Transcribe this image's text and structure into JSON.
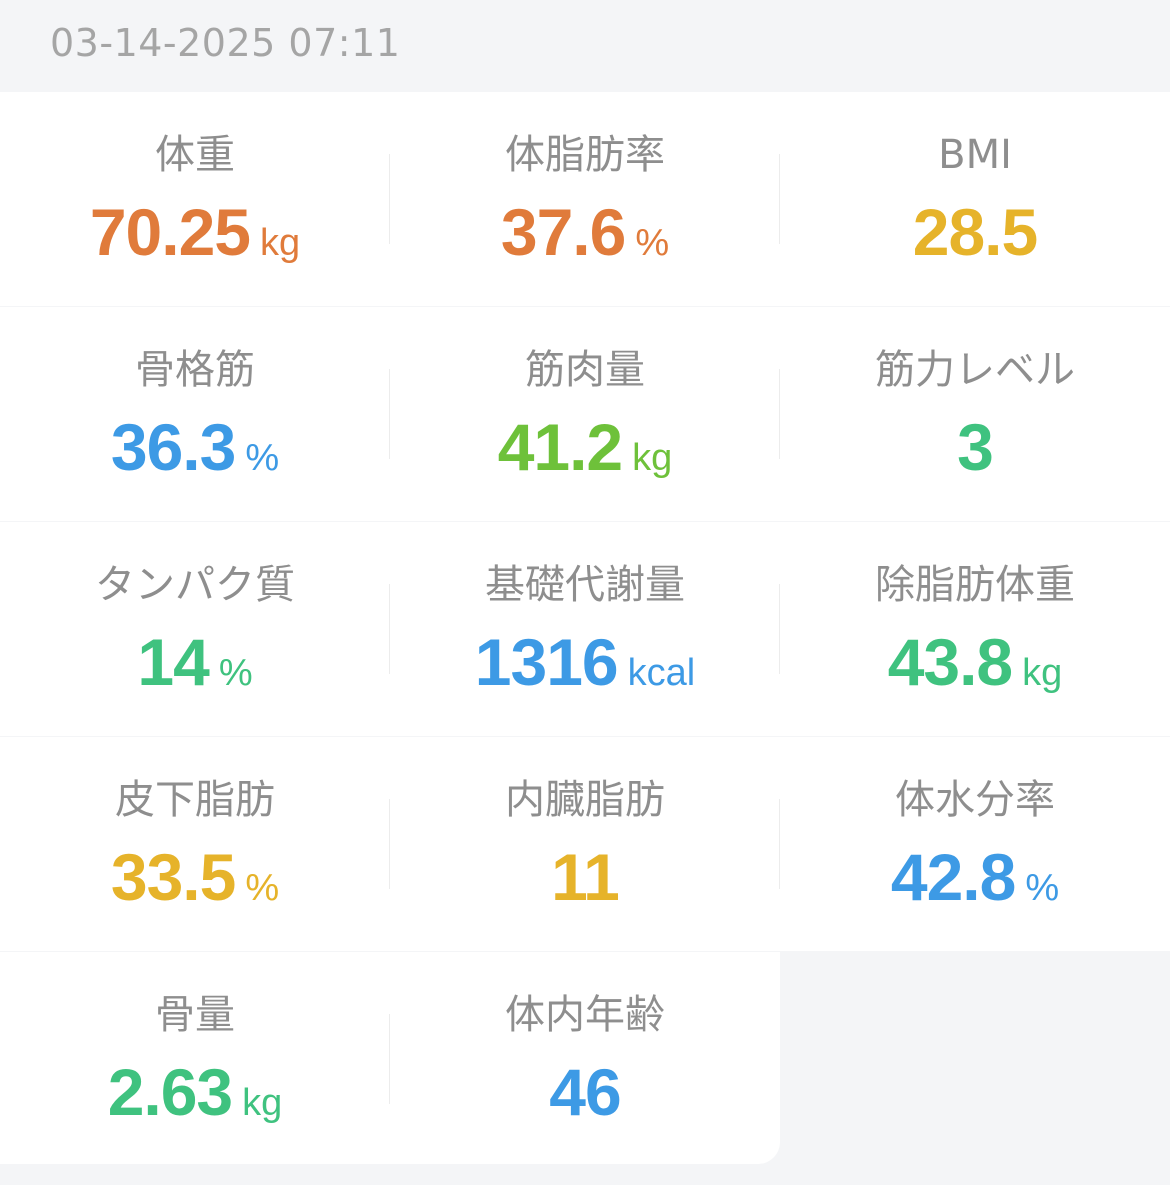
{
  "timestamp": "03-14-2025 07:11",
  "metrics": [
    {
      "label": "体重",
      "value": "70.25",
      "unit": "kg",
      "color": "#e07b3b"
    },
    {
      "label": "体脂肪率",
      "value": "37.6",
      "unit": "%",
      "color": "#e07b3b"
    },
    {
      "label": "BMI",
      "value": "28.5",
      "unit": "",
      "color": "#e6b32a"
    },
    {
      "label": "骨格筋",
      "value": "36.3",
      "unit": "%",
      "color": "#3d9ae5"
    },
    {
      "label": "筋肉量",
      "value": "41.2",
      "unit": "kg",
      "color": "#6ec13a"
    },
    {
      "label": "筋力レベル",
      "value": "3",
      "unit": "",
      "color": "#3fc27f"
    },
    {
      "label": "タンパク質",
      "value": "14",
      "unit": "%",
      "color": "#3fc27f"
    },
    {
      "label": "基礎代謝量",
      "value": "1316",
      "unit": "kcal",
      "color": "#3d9ae5"
    },
    {
      "label": "除脂肪体重",
      "value": "43.8",
      "unit": "kg",
      "color": "#3fc27f"
    },
    {
      "label": "皮下脂肪",
      "value": "33.5",
      "unit": "%",
      "color": "#e6b32a"
    },
    {
      "label": "内臓脂肪",
      "value": "11",
      "unit": "",
      "color": "#e6b32a"
    },
    {
      "label": "体水分率",
      "value": "42.8",
      "unit": "%",
      "color": "#3d9ae5"
    },
    {
      "label": "骨量",
      "value": "2.63",
      "unit": "kg",
      "color": "#3fc27f"
    },
    {
      "label": "体内年齢",
      "value": "46",
      "unit": "",
      "color": "#3d9ae5"
    }
  ]
}
